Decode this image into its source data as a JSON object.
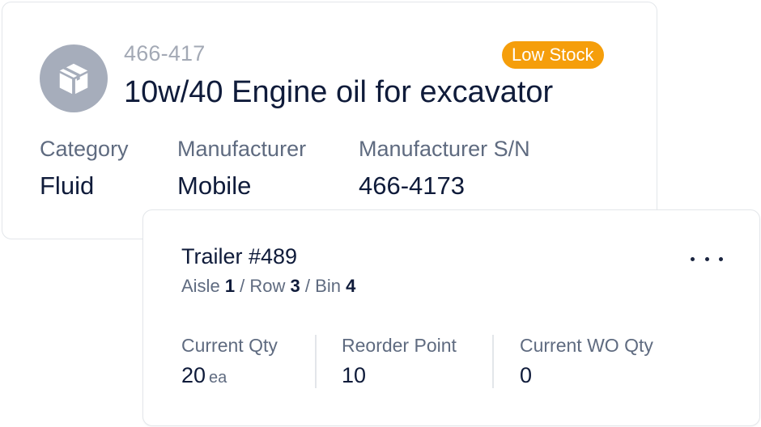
{
  "part": {
    "number": "466-417",
    "title": "10w/40 Engine oil for excavator",
    "status_badge": "Low Stock",
    "icon": "package-box-icon",
    "fields": [
      {
        "label": "Category",
        "value": "Fluid"
      },
      {
        "label": "Manufacturer",
        "value": "Mobile"
      },
      {
        "label": "Manufacturer S/N",
        "value": "466-4173"
      }
    ]
  },
  "location": {
    "name": "Trailer #489",
    "path": {
      "aisle_label": "Aisle",
      "aisle": "1",
      "row_label": "Row",
      "row": "3",
      "bin_label": "Bin",
      "bin": "4"
    },
    "stats": [
      {
        "label": "Current Qty",
        "value": "20",
        "unit": "ea"
      },
      {
        "label": "Reorder Point",
        "value": "10"
      },
      {
        "label": "Current WO Qty",
        "value": "0"
      }
    ],
    "more_icon": "more-horizontal-icon"
  },
  "colors": {
    "badge": "#f59e0b",
    "avatar": "#a6adbb",
    "text_primary": "#0f1b3a",
    "text_secondary": "#5f6b80"
  }
}
